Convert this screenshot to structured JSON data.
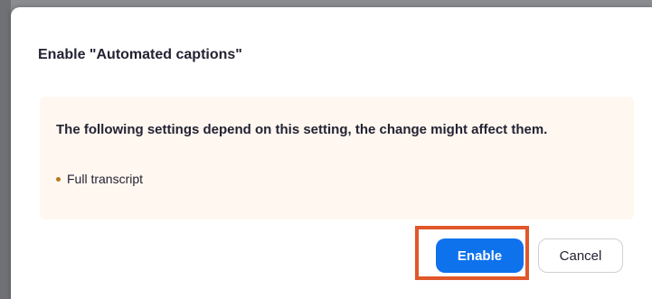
{
  "dialog": {
    "title": "Enable \"Automated captions\"",
    "notice": {
      "message": "The following settings depend on this setting, the change might affect them.",
      "dependents": [
        "Full transcript"
      ]
    },
    "buttons": {
      "enable_label": "Enable",
      "cancel_label": "Cancel"
    }
  },
  "colors": {
    "primary": "#0e72ed",
    "notice_background": "#fff7f0",
    "bullet": "#b7791f",
    "highlight": "#e0572a"
  }
}
